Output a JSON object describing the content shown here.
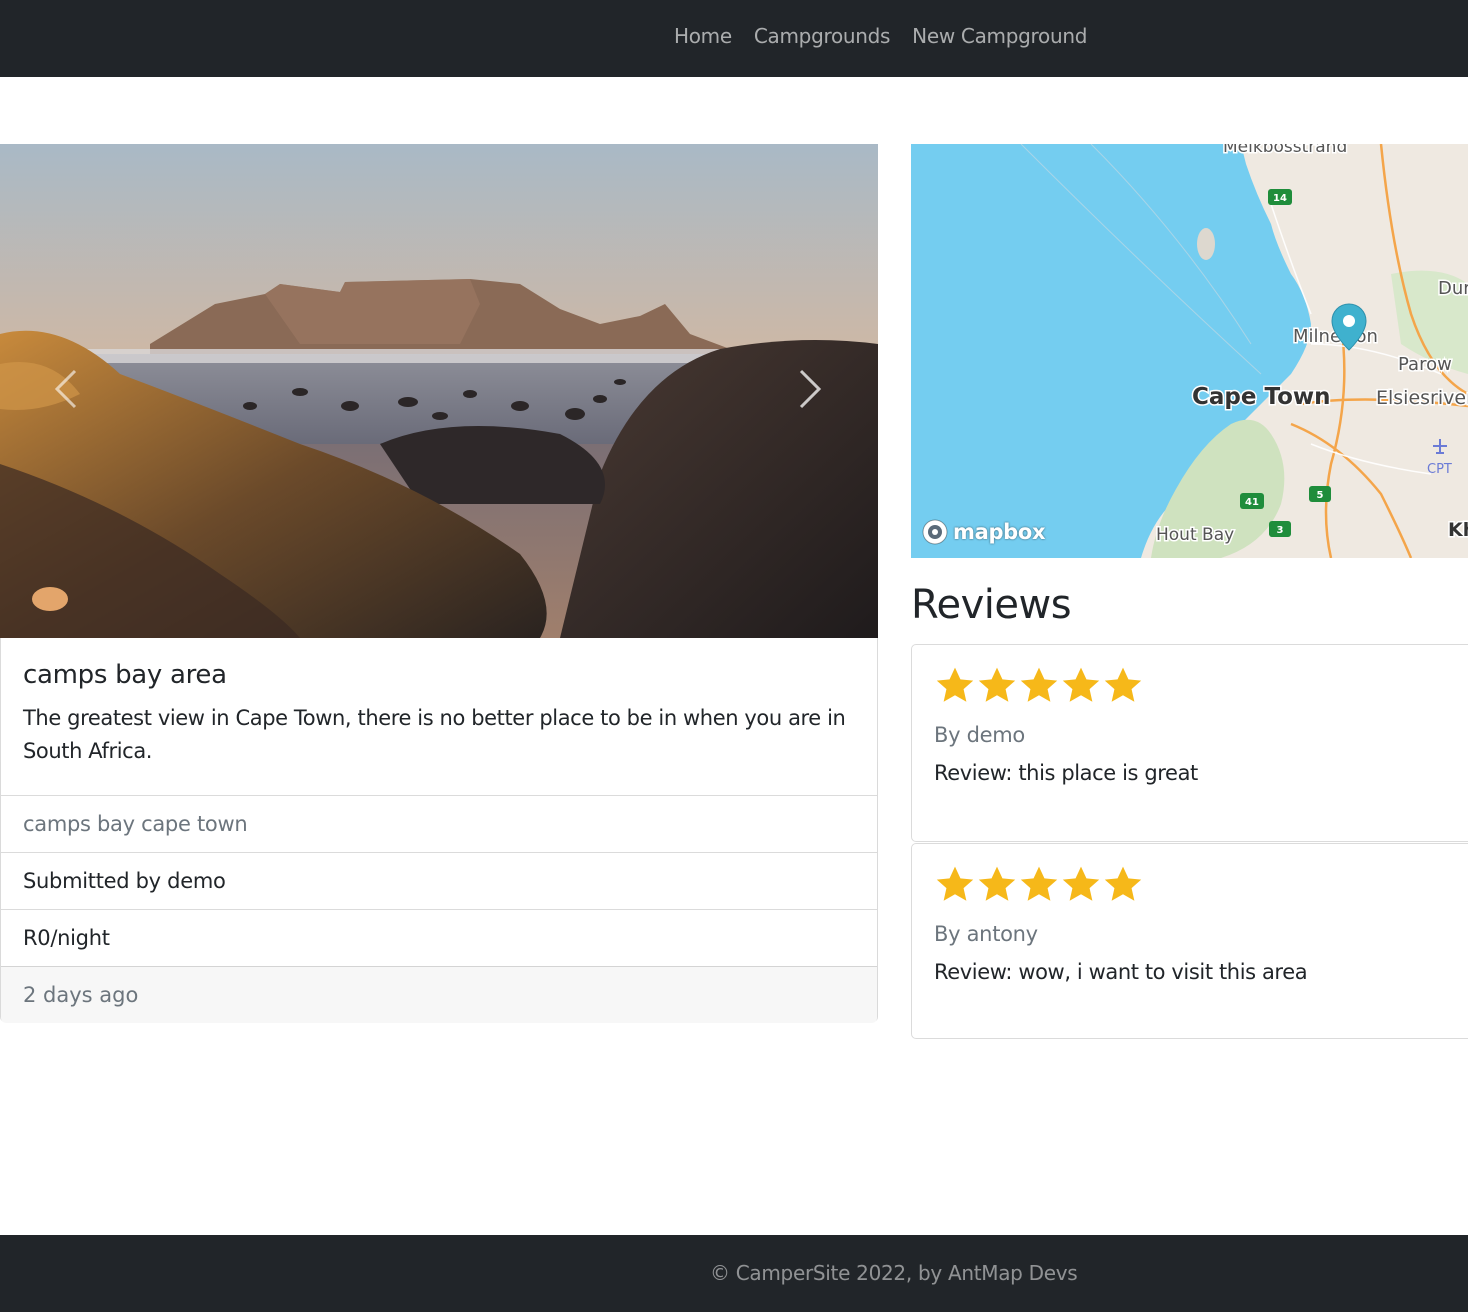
{
  "nav": {
    "links": [
      "Home",
      "Campgrounds",
      "New Campground"
    ]
  },
  "carousel": {
    "prev_icon": "chevron-left-icon",
    "next_icon": "chevron-right-icon"
  },
  "campground": {
    "title": "camps bay area",
    "description": "The greatest view in Cape Town, there is no better place to be in when you are in South Africa.",
    "location": "camps bay cape town",
    "submitted_by": "Submitted by demo",
    "price": "R0/night",
    "posted": "2 days ago"
  },
  "map": {
    "attribution": "mapbox",
    "labels": {
      "melkbosstrand": "Melkbosstrand",
      "durbanville": "Dur",
      "milnerton": "Milnerton",
      "parow": "Parow",
      "cape_town": "Cape Town",
      "elsiesriver": "Elsiesriver",
      "cpt": "CPT",
      "hout_bay": "Hout Bay",
      "khayelitsha": "Kh",
      "route_14": "14",
      "route_41": "41",
      "route_5": "5",
      "route_3": "3"
    }
  },
  "reviews": {
    "title": "Reviews",
    "star_color": "#f6b819",
    "items": [
      {
        "rating": 5,
        "author": "By demo",
        "text": "Review: this place is great"
      },
      {
        "rating": 5,
        "author": "By antony",
        "text": "Review: wow, i want to visit this area"
      }
    ]
  },
  "footer": {
    "text": "© CamperSite 2022, by AntMap Devs"
  }
}
